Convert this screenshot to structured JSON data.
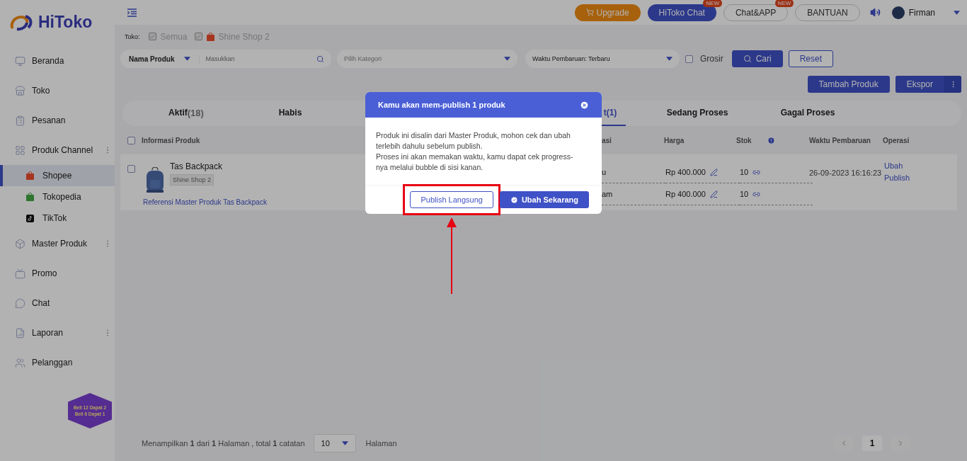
{
  "logo": {
    "text": "HiToko"
  },
  "sidebar": {
    "items": [
      {
        "label": "Beranda",
        "expandable": false,
        "selected": false
      },
      {
        "label": "Toko",
        "expandable": false,
        "selected": false
      },
      {
        "label": "Pesanan",
        "expandable": false,
        "selected": false
      },
      {
        "label": "Produk Channel",
        "expandable": true,
        "selected": false,
        "children": [
          {
            "label": "Shopee",
            "selected": true
          },
          {
            "label": "Tokopedia",
            "selected": false
          },
          {
            "label": "TikTok",
            "selected": false
          }
        ]
      },
      {
        "label": "Master Produk",
        "expandable": true,
        "selected": false
      },
      {
        "label": "Promo",
        "expandable": false,
        "selected": false
      },
      {
        "label": "Chat",
        "expandable": false,
        "selected": false
      },
      {
        "label": "Laporan",
        "expandable": true,
        "selected": false
      },
      {
        "label": "Pelanggan",
        "expandable": false,
        "selected": false
      }
    ]
  },
  "promo_badge": {
    "lines": [
      "Beli 12 Dapat 2",
      "Beli 6 Dapat 1"
    ]
  },
  "topbar": {
    "upgrade": "Upgrade",
    "buttons": [
      {
        "label": "HiToko Chat",
        "kind": "primary",
        "badge": "NEW"
      },
      {
        "label": "Chat&APP",
        "kind": "outline",
        "badge": "NEW"
      },
      {
        "label": "BANTUAN",
        "kind": "outline"
      }
    ],
    "user": "Firman"
  },
  "filters": {
    "store_label": "Toko:",
    "stores": [
      {
        "label": "Semua",
        "checked": true
      },
      {
        "label": "Shine Shop 2",
        "checked": true
      }
    ],
    "search_type": "Nama Produk",
    "search_placeholder": "Masukkan",
    "category_placeholder": "Pilih Kategori",
    "sort": "Waktu Pembaruan: Terbaru",
    "grosir": {
      "label": "Grosir",
      "checked": false
    },
    "search_button": "Cari",
    "reset_button": "Reset"
  },
  "actions": [
    "Tambah Produk",
    "Ekspor"
  ],
  "tabs": [
    {
      "label": "Aktif",
      "count": "(18)",
      "selected": false
    },
    {
      "label": "Habis",
      "selected": false
    },
    {
      "label": "t(1)",
      "selected": true
    },
    {
      "label": "Sedang Proses",
      "selected": false
    },
    {
      "label": "Gagal Proses",
      "selected": false
    }
  ],
  "table": {
    "all_checked": false,
    "columns": [
      "Informasi Produk",
      "asi",
      "Harga",
      "Stok",
      "Waktu Pembaruan",
      "Operasi"
    ],
    "rows": [
      {
        "checked": false,
        "name": "Tas Backpack",
        "store": "Shine Shop 2",
        "reference": "Referensi Master Produk Tas Backpack",
        "variants": [
          {
            "variation": "u",
            "price": "Rp 400.000",
            "stock": "10"
          },
          {
            "variation": "am",
            "price": "Rp 400.000",
            "stock": "10"
          }
        ],
        "updated": "26-09-2023 16:16:23",
        "operations": [
          "Ubah",
          "Publish"
        ]
      }
    ]
  },
  "pagination": {
    "summary": "Menampilkan **1** dari **1** Halaman , total **1** catatan",
    "page_size": "10",
    "pages_label": "Halaman",
    "pages": [
      {
        "label": "1",
        "selected": true
      }
    ]
  },
  "dialog": {
    "title": "Kamu akan mem-publish 1 produk",
    "paragraphs": [
      "Produk ini disalin dari Master Produk, mohon cek dan ubah terlebih dahulu sebelum publish.",
      "Proses ini akan memakan waktu, kamu dapat cek progress-nya melalui bubble di sisi kanan."
    ],
    "buttons": [
      {
        "label": "Publish Langsung",
        "kind": "secondary",
        "highlighted": true
      },
      {
        "label": "Ubah Sekarang",
        "kind": "primary",
        "highlighted": false
      }
    ]
  }
}
